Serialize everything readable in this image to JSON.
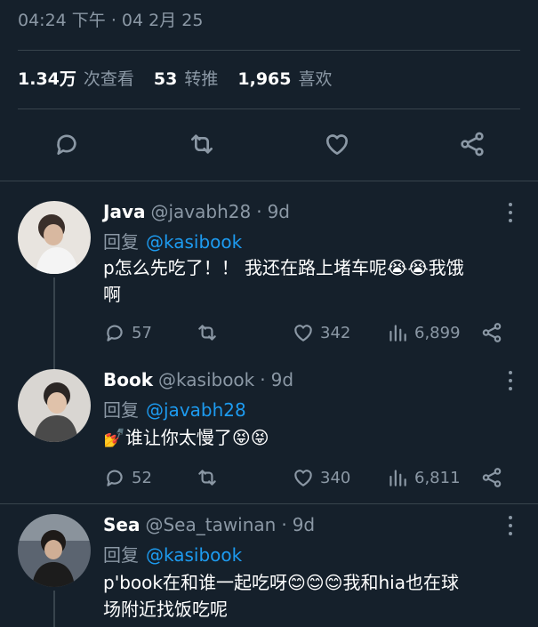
{
  "tweet": {
    "timestamp": "04:24 下午 · 04 2月 25",
    "stats": [
      {
        "value": "1.34万",
        "label": "次查看"
      },
      {
        "value": "53",
        "label": "转推"
      },
      {
        "value": "1,965",
        "label": "喜欢"
      }
    ],
    "actions": [
      "reply-icon",
      "retweet-icon",
      "like-icon",
      "share-icon"
    ]
  },
  "reply_prefix": "回复",
  "replies": [
    {
      "name": "Java",
      "handle": "@javabh28",
      "dot": "·",
      "time": "9d",
      "reply_to": "@kasibook",
      "text_line1": "p怎么先吃了！！ 我还在路上堵车呢😭😭我饿",
      "text_line2": "啊",
      "replies": "57",
      "retweets": "",
      "likes": "342",
      "views": "6,899"
    },
    {
      "name": "Book",
      "handle": "@kasibook",
      "dot": "·",
      "time": "9d",
      "reply_to": "@javabh28",
      "text_line1": "💅谁让你太慢了😝😝",
      "text_line2": "",
      "replies": "52",
      "retweets": "",
      "likes": "340",
      "views": "6,811"
    },
    {
      "name": "Sea",
      "handle": "@Sea_tawinan",
      "dot": "·",
      "time": "9d",
      "reply_to": "@kasibook",
      "text_line1": "p'book在和谁一起吃呀😊😊😊我和hia也在球",
      "text_line2": "场附近找饭吃呢",
      "replies": "",
      "retweets": "",
      "likes": "",
      "views": ""
    }
  ],
  "colors": {
    "background": "#15202b",
    "muted": "#8b98a5",
    "accent": "#1d9bf0",
    "divider": "#38444d"
  }
}
